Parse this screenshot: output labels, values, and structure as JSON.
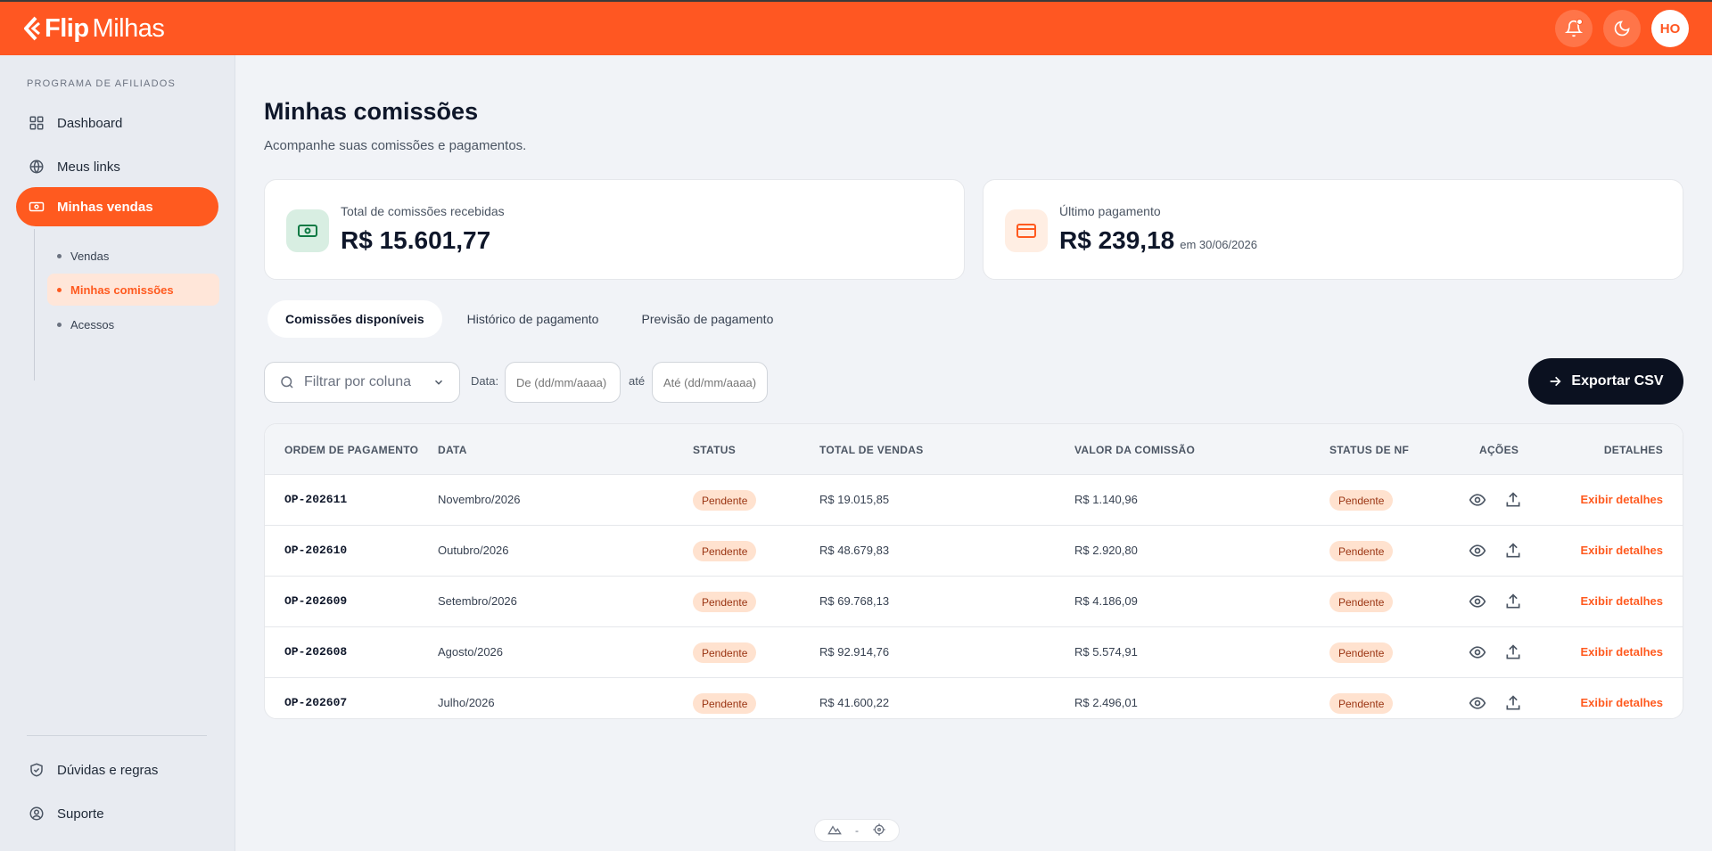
{
  "brand": {
    "bold": "Flip",
    "regular": "Milhas"
  },
  "header": {
    "avatar_initials": "HO"
  },
  "sidebar": {
    "section_title": "PROGRAMA DE AFILIADOS",
    "items": [
      {
        "label": "Dashboard",
        "icon": "grid-icon"
      },
      {
        "label": "Meus links",
        "icon": "globe-icon"
      },
      {
        "label": "Minhas vendas",
        "icon": "money-icon"
      }
    ],
    "subitems": [
      {
        "label": "Vendas"
      },
      {
        "label": "Minhas comissões"
      },
      {
        "label": "Acessos"
      }
    ],
    "bottom": [
      {
        "label": "Dúvidas e regras",
        "icon": "shield-check-icon"
      },
      {
        "label": "Suporte",
        "icon": "user-circle-icon"
      }
    ]
  },
  "page": {
    "title": "Minhas comissões",
    "subtitle": "Acompanhe suas comissões e pagamentos."
  },
  "cards": {
    "total": {
      "label": "Total de comissões recebidas",
      "value": "R$ 15.601,77"
    },
    "last": {
      "label": "Último pagamento",
      "value": "R$ 239,18",
      "suffix": "em 30/06/2026"
    }
  },
  "tabs": [
    "Comissões disponíveis",
    "Histórico de pagamento",
    "Previsão de pagamento"
  ],
  "filters": {
    "select_placeholder": "Filtrar por coluna",
    "date_label": "Data:",
    "from_placeholder": "De (dd/mm/aaaa)",
    "to_label": "até",
    "to_placeholder": "Até (dd/mm/aaaa)",
    "export_label": "Exportar CSV"
  },
  "table": {
    "columns": [
      "ORDEM DE PAGAMENTO",
      "DATA",
      "STATUS",
      "TOTAL DE VENDAS",
      "VALOR DA COMISSÃO",
      "STATUS DE NF",
      "AÇÕES",
      "DETALHES"
    ],
    "rows": [
      {
        "op": "OP-202611",
        "date": "Novembro/2026",
        "status": "Pendente",
        "total": "R$ 19.015,85",
        "commission": "R$ 1.140,96",
        "nf": "Pendente",
        "details": "Exibir detalhes"
      },
      {
        "op": "OP-202610",
        "date": "Outubro/2026",
        "status": "Pendente",
        "total": "R$ 48.679,83",
        "commission": "R$ 2.920,80",
        "nf": "Pendente",
        "details": "Exibir detalhes"
      },
      {
        "op": "OP-202609",
        "date": "Setembro/2026",
        "status": "Pendente",
        "total": "R$ 69.768,13",
        "commission": "R$ 4.186,09",
        "nf": "Pendente",
        "details": "Exibir detalhes"
      },
      {
        "op": "OP-202608",
        "date": "Agosto/2026",
        "status": "Pendente",
        "total": "R$ 92.914,76",
        "commission": "R$ 5.574,91",
        "nf": "Pendente",
        "details": "Exibir detalhes"
      },
      {
        "op": "OP-202607",
        "date": "Julho/2026",
        "status": "Pendente",
        "total": "R$ 41.600,22",
        "commission": "R$ 2.496,01",
        "nf": "Pendente",
        "details": "Exibir detalhes"
      }
    ]
  },
  "bottom_widget": {
    "separator": "-"
  },
  "colors": {
    "brand": "#ff5722",
    "accent": "#ff5a1f",
    "dark": "#0b1120",
    "badge_bg": "#ffe2cf"
  }
}
